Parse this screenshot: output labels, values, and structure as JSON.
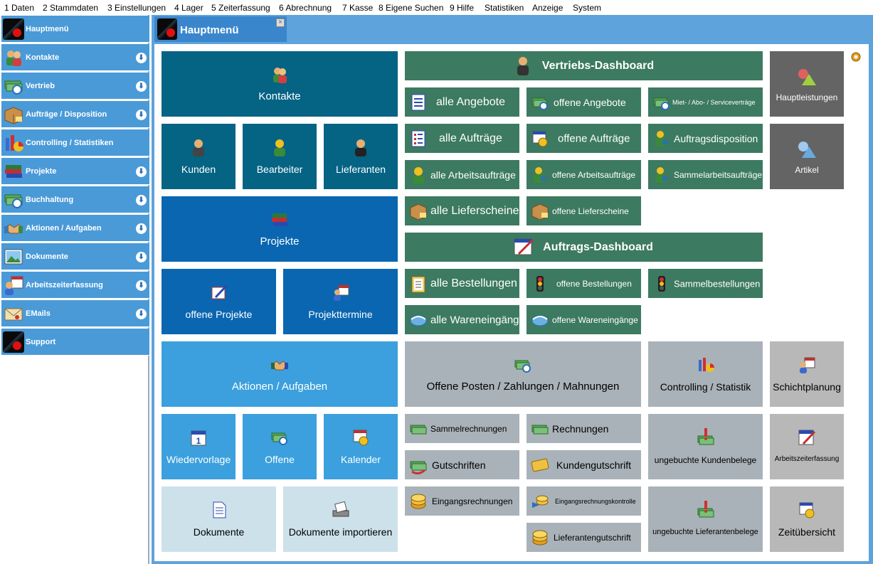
{
  "menu": [
    "1 Daten",
    "2 Stammdaten",
    "3 Einstellungen",
    "4 Lager",
    "5 Zeiterfassung",
    "6 Abrechnung",
    "7 Kasse",
    "8 Eigene Suchen",
    "9 Hilfe",
    "Statistiken",
    "Anzeige",
    "System"
  ],
  "sidebar": [
    {
      "label": "Hauptmenü",
      "icon": "app-logo-icon",
      "arrow": false
    },
    {
      "label": "Kontakte",
      "icon": "contacts-icon",
      "arrow": true
    },
    {
      "label": "Vertrieb",
      "icon": "money-icon",
      "arrow": true
    },
    {
      "label": "Aufträge / Disposition",
      "icon": "package-icon",
      "arrow": true
    },
    {
      "label": "Controlling / Statistiken",
      "icon": "chart-icon",
      "arrow": false
    },
    {
      "label": "Projekte",
      "icon": "books-icon",
      "arrow": true
    },
    {
      "label": "Buchhaltung",
      "icon": "money-icon",
      "arrow": true
    },
    {
      "label": "Aktionen / Aufgaben",
      "icon": "handshake-icon",
      "arrow": true
    },
    {
      "label": "Dokumente",
      "icon": "picture-icon",
      "arrow": true
    },
    {
      "label": "Arbeitszeiterfassung",
      "icon": "calendar-person-icon",
      "arrow": true
    },
    {
      "label": "EMails",
      "icon": "envelope-icon",
      "arrow": true
    },
    {
      "label": "Support",
      "icon": "app-logo-icon",
      "arrow": false
    }
  ],
  "tab": {
    "title": "Hauptmenü",
    "close": "×"
  },
  "tiles": {
    "kontakte": "Kontakte",
    "kunden": "Kunden",
    "bearbeiter": "Bearbeiter",
    "lieferanten": "Lieferanten",
    "projekte": "Projekte",
    "offene_projekte": "offene Projekte",
    "projekttermine": "Projekttermine",
    "aktionen": "Aktionen / Aufgaben",
    "wiedervorlage": "Wiedervorlage",
    "offene": "Offene",
    "kalender": "Kalender",
    "dokumente": "Dokumente",
    "dokumente_importieren": "Dokumente importieren",
    "vertriebs_dashboard": "Vertriebs-Dashboard",
    "alle_angebote": "alle Angebote",
    "offene_angebote": "offene Angebote",
    "mietvertraege": "Miet- / Abo- / Serviceverträge",
    "alle_auftraege": "alle Aufträge",
    "offene_auftraege": "offene Aufträge",
    "auftragsdisposition": "Auftragsdisposition",
    "alle_arbeitsauftraege": "alle Arbeitsaufträge",
    "offene_arbeitsauftraege": "offene Arbeitsaufträge",
    "sammelarbeitsauftraege": "Sammelarbeitsaufträge",
    "alle_lieferscheine": "alle Lieferscheine",
    "offene_lieferscheine": "offene Lieferscheine",
    "auftrags_dashboard": "Auftrags-Dashboard",
    "alle_bestellungen": "alle Bestellungen",
    "offene_bestellungen": "offene Bestellungen",
    "sammelbestellungen": "Sammelbestellungen",
    "alle_wareneingaenge": "alle Wareneingänge",
    "offene_wareneingaenge": "offene Wareneingänge",
    "hauptleistungen": "Hauptleistungen",
    "artikel": "Artikel",
    "offene_posten": "Offene Posten / Zahlungen / Mahnungen",
    "controlling": "Controlling / Statistik",
    "schichtplanung": "Schichtplanung",
    "sammelrechnungen": "Sammelrechnungen",
    "rechnungen": "Rechnungen",
    "gutschriften": "Gutschriften",
    "kundengutschrift": "Kundengutschrift",
    "eingangsrechnungen": "Eingangsrechnungen",
    "eingangsrechnungskontrolle": "Eingangsrechnungskontrolle",
    "lieferantengutschrift": "Lieferantengutschrift",
    "ungebuchte_kundenbelege": "ungebuchte Kundenbelege",
    "arbeitszeiterfassung": "Arbeitszeiterfassung",
    "ungebuchte_lieferantenbelege": "ungebuchte Lieferantenbelege",
    "zeituebersicht": "Zeitübersicht"
  },
  "colors": {
    "accent": "#4a9ad8",
    "teal": "#056384",
    "blue": "#0a66b0",
    "green": "#3c7a61",
    "grey": "#646464"
  }
}
